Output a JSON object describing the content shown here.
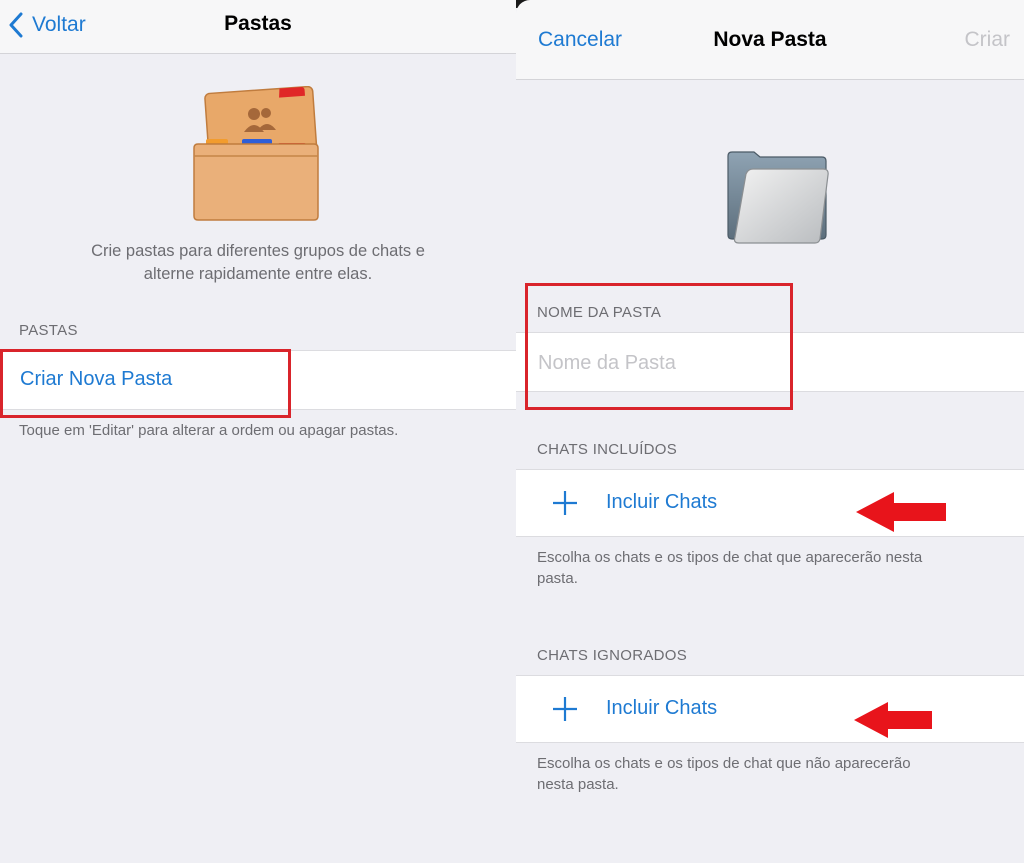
{
  "left": {
    "nav": {
      "back_label": "Voltar",
      "title": "Pastas"
    },
    "illustration_icon": "folder-with-group-icon",
    "description_line1": "Crie pastas para diferentes grupos de chats e",
    "description_line2": "alterne rapidamente entre elas.",
    "section_header": "PASTAS",
    "create_button_label": "Criar Nova Pasta",
    "footer_text": "Toque em 'Editar' para alterar a ordem ou apagar pastas."
  },
  "right": {
    "nav": {
      "cancel_label": "Cancelar",
      "title": "Nova Pasta",
      "create_label": "Criar"
    },
    "folder_icon": "empty-folder-icon",
    "name_section_header": "NOME DA PASTA",
    "name_placeholder": "Nome da Pasta",
    "name_value": "",
    "included_header": "CHATS INCLUÍDOS",
    "included_button_label": "Incluir Chats",
    "included_footer_line1": "Escolha os chats e os tipos de chat que aparecerão nesta",
    "included_footer_line2": "pasta.",
    "ignored_header": "CHATS IGNORADOS",
    "ignored_button_label": "Incluir Chats",
    "ignored_footer_line1": "Escolha os chats e os tipos de chat que não aparecerão",
    "ignored_footer_line2": "nesta pasta."
  },
  "colors": {
    "accent": "#1e7ad2",
    "highlight_red": "#d9242b",
    "disabled": "#c4c4c8",
    "background": "#efeff4"
  }
}
